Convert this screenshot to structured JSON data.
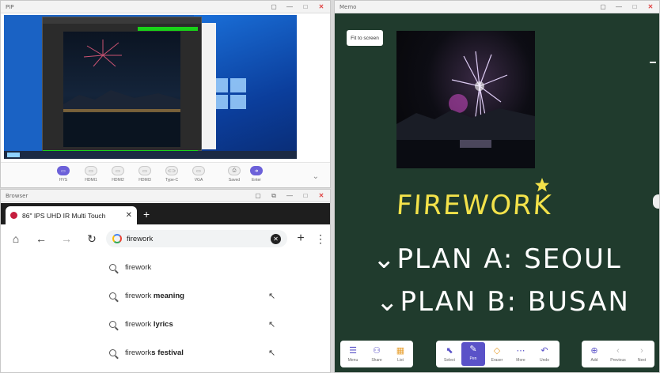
{
  "pip": {
    "title": "PIP",
    "window_controls": [
      "▢",
      "—",
      "□",
      "✕"
    ],
    "sources": [
      {
        "label": "HYS",
        "active": true
      },
      {
        "label": "HDMI1",
        "active": false
      },
      {
        "label": "HDMI2",
        "active": false
      },
      {
        "label": "HDMI3",
        "active": false
      },
      {
        "label": "Type-C",
        "active": false
      },
      {
        "label": "VGA",
        "active": false
      },
      {
        "label": "Saved",
        "active": false
      },
      {
        "label": "Enter",
        "active": false
      }
    ]
  },
  "browser": {
    "title": "Browser",
    "window_controls": [
      "▢",
      "⧉",
      "—",
      "□",
      "✕"
    ],
    "tab_title": "86\" IPS UHD IR Multi Touch",
    "omnibox_query": "firework",
    "suggestions": [
      {
        "prefix": "firework",
        "bold": ""
      },
      {
        "prefix": "firework ",
        "bold": "meaning"
      },
      {
        "prefix": "firework ",
        "bold": "lyrics"
      },
      {
        "prefix": "firework",
        "bold": "s festival"
      }
    ]
  },
  "memo": {
    "title": "Memo",
    "window_controls": [
      "▢",
      "—",
      "□",
      "✕"
    ],
    "fit_button": "Fit to screen",
    "handwriting": {
      "title": "FIREWORK",
      "line1": "⌄PLAN A: SEOUL",
      "line2": "⌄PLAN B: BUSAN"
    },
    "toolbar_left": [
      {
        "icon": "☰",
        "label": "Menu"
      },
      {
        "icon": "⚇",
        "label": "Share"
      },
      {
        "icon": "▦",
        "label": "List"
      }
    ],
    "toolbar_center": [
      {
        "icon": "⬉",
        "label": "Select",
        "active": false
      },
      {
        "icon": "✎",
        "label": "Pen",
        "active": true
      },
      {
        "icon": "◇",
        "label": "Eraser",
        "active": false
      },
      {
        "icon": "⋯",
        "label": "More",
        "active": false
      },
      {
        "icon": "↶",
        "label": "Undo",
        "active": false
      }
    ],
    "toolbar_right": [
      {
        "icon": "⊕",
        "label": "Add"
      },
      {
        "icon": "‹",
        "label": "Previous"
      },
      {
        "icon": "›",
        "label": "Next"
      }
    ]
  },
  "colors": {
    "accent": "#5a52c8",
    "board": "#203b2d",
    "highlight_ink": "#f3e24a"
  }
}
